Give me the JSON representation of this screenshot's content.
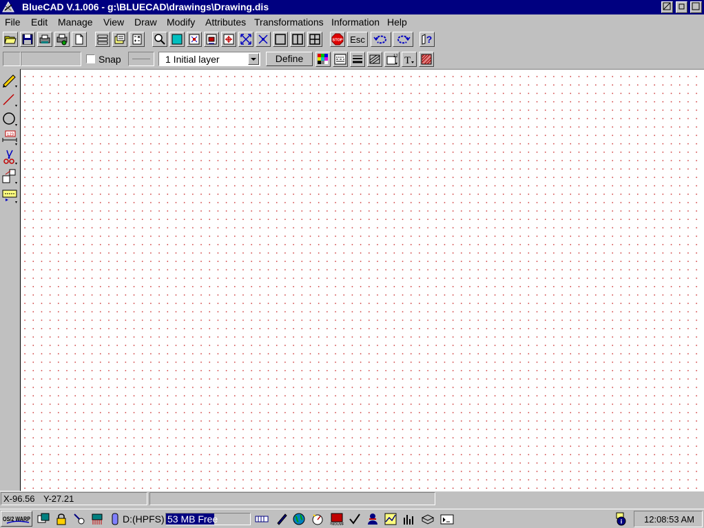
{
  "window": {
    "title": "BlueCAD V.1.006 - g:\\BLUECAD\\drawings\\Drawing.dis"
  },
  "menu": {
    "items": [
      "File",
      "Edit",
      "Manage",
      "View",
      "Draw",
      "Modify",
      "Attributes",
      "Transformations",
      "Information",
      "Help"
    ]
  },
  "toolbar": {
    "esc_label": "Esc",
    "stop_label": "STOP"
  },
  "toolbar2": {
    "snap_label": "Snap",
    "snap_checked": false,
    "layer_value": "1 Initial layer",
    "define_label": "Define"
  },
  "palette": {
    "icons": [
      "pencil-icon",
      "line-icon",
      "circle-icon",
      "dimension-icon",
      "scissors-icon",
      "transform-icon",
      "attribute-icon"
    ]
  },
  "status": {
    "x_coord": "X-96.56",
    "y_coord": "Y-27.21"
  },
  "taskbar": {
    "logo_text": "OS/2 WARP",
    "drive_label": "D:(HPFS)",
    "drive_free": "53 MB Free",
    "drive_free_fraction": 0.57,
    "clock": "12:08:53 AM"
  },
  "colors": {
    "title_bar": "#000080",
    "face": "#c0c0c0",
    "grid_dot": "#d04040"
  }
}
